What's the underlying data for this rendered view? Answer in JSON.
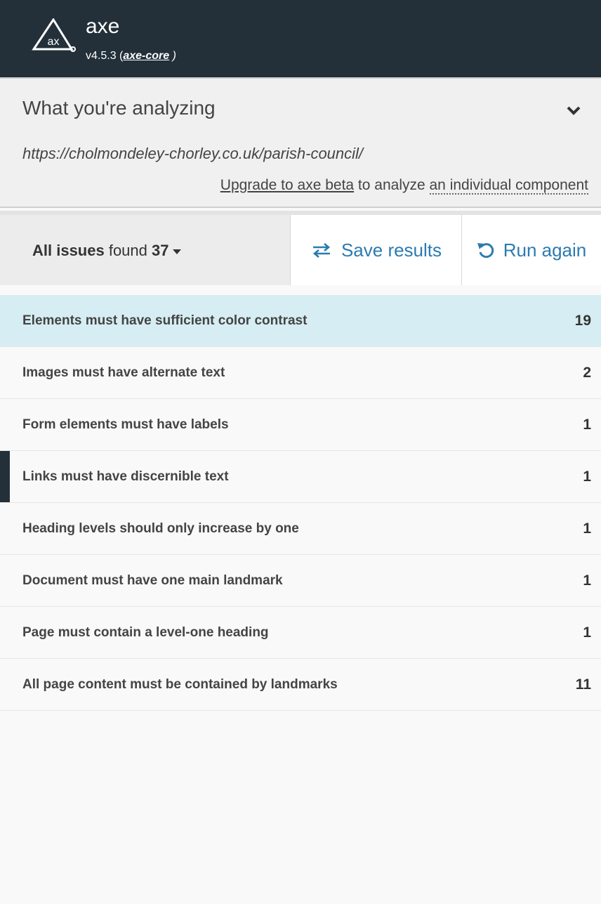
{
  "header": {
    "app_name": "axe",
    "version_prefix": "v4.5.3 (",
    "core_link": "axe-core",
    "version_suffix": " )"
  },
  "analyze": {
    "title": "What you're analyzing",
    "url": "https://cholmondeley-chorley.co.uk/parish-council/",
    "upgrade_link": "Upgrade to axe beta",
    "upgrade_mid": " to analyze ",
    "component_link": "an individual component"
  },
  "toolbar": {
    "filter_bold": "All issues",
    "filter_text": " found ",
    "filter_count": "37",
    "save_label": "Save results",
    "run_label": "Run again"
  },
  "issues": [
    {
      "label": "Elements must have sufficient color contrast",
      "count": "19"
    },
    {
      "label": "Images must have alternate text",
      "count": "2"
    },
    {
      "label": "Form elements must have labels",
      "count": "1"
    },
    {
      "label": "Links must have discernible text",
      "count": "1"
    },
    {
      "label": "Heading levels should only increase by one",
      "count": "1"
    },
    {
      "label": "Document must have one main landmark",
      "count": "1"
    },
    {
      "label": "Page must contain a level-one heading",
      "count": "1"
    },
    {
      "label": "All page content must be contained by landmarks",
      "count": "11"
    }
  ],
  "colors": {
    "header_bg": "#23303a",
    "accent": "#2b7bb0",
    "selected_row": "#d6eef3"
  }
}
